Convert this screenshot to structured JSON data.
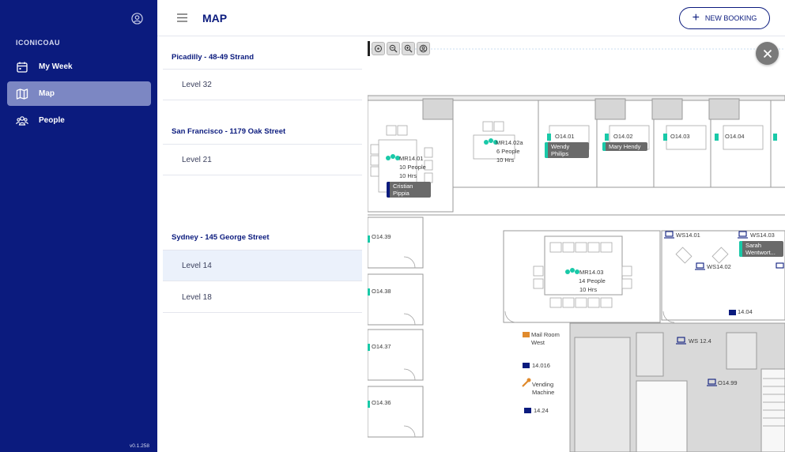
{
  "sidebar": {
    "brand": "ICONICOAU",
    "items": [
      {
        "label": "My Week",
        "icon": "calendar-icon"
      },
      {
        "label": "Map",
        "icon": "map-icon",
        "active": true
      },
      {
        "label": "People",
        "icon": "people-icon"
      }
    ],
    "version": "v0.1.258"
  },
  "header": {
    "title": "MAP",
    "new_booking_label": "NEW BOOKING"
  },
  "locations": [
    {
      "name": "Picadilly - 48-49 Strand",
      "levels": [
        "Level 32"
      ]
    },
    {
      "name": "San Francisco - 1179 Oak Street",
      "levels": [
        "Level 21"
      ]
    },
    {
      "name": "Sydney - 145 George Street",
      "levels": [
        "Level 14",
        "Level 18"
      ],
      "selected_level": "Level 14"
    }
  ],
  "map": {
    "rooms": {
      "mr1401": {
        "name": "MR14.01",
        "capacity": "10 People",
        "duration": "10 Hrs",
        "occupant": "Cristian Pippia"
      },
      "mr1402a": {
        "name": "MR14.02a",
        "capacity": "6 People",
        "duration": "10 Hrs"
      },
      "mr1403": {
        "name": "MR14.03",
        "capacity": "14 People",
        "duration": "10 Hrs"
      }
    },
    "offices": {
      "o1401": {
        "name": "O14.01",
        "occupant": "Wendy Philips"
      },
      "o1402": {
        "name": "O14.02",
        "occupant": "Mary Hendy"
      },
      "o1403": {
        "name": "O14.03"
      },
      "o1404": {
        "name": "O14.04"
      },
      "o1439": {
        "name": "O14.39"
      },
      "o1438": {
        "name": "O14.38"
      },
      "o1437": {
        "name": "O14.37"
      },
      "o1436": {
        "name": "O14.36"
      },
      "o1499": {
        "name": "O14.99"
      }
    },
    "workstations": {
      "ws1401": {
        "name": "WS14.01"
      },
      "ws1402": {
        "name": "WS14.02"
      },
      "ws1403": {
        "name": "WS14.03",
        "occupant": "Sarah Wentwort..."
      },
      "ws124": {
        "name": "WS 12.4"
      }
    },
    "facilities": {
      "mail_room": "Mail Room West",
      "vending": "Vending Machine",
      "p14016": "14.016",
      "p1424": "14.24",
      "p1404": "14.04"
    },
    "colors": {
      "accent": "#19c9a8",
      "navy": "#0b1b7e",
      "tag": "#6a6a6a"
    }
  }
}
